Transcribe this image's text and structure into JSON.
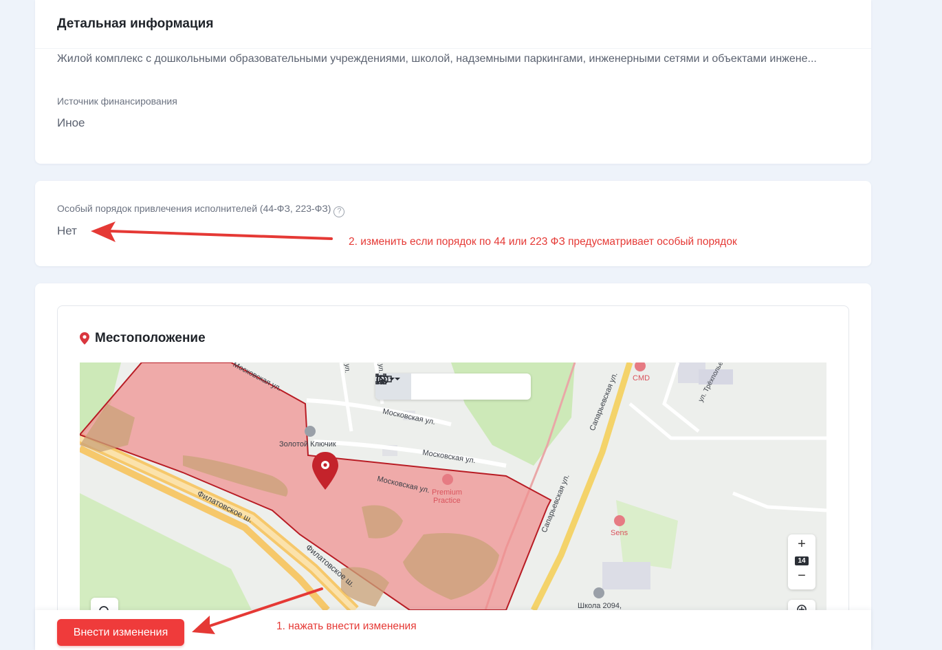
{
  "details": {
    "title": "Детальная информация",
    "description": "Жилой комплекс с дошкольными образовательными учреждениями, школой, надземными паркингами, инженерными сетями и объектами инжене...",
    "funding_label": "Источник финансирования",
    "funding_value": "Иное"
  },
  "special_order": {
    "label": "Особый порядок привлечения исполнителей (44-ФЗ, 223-ФЗ)",
    "help_glyph": "?",
    "value": "Нет",
    "annotation": "2. изменить если порядок по 44 или 223 ФЗ предусматривает особый порядок"
  },
  "location": {
    "title": "Местоположение",
    "icon": "location-pin-icon",
    "map": {
      "zoom_level": "14",
      "zoom_in": "+",
      "zoom_out": "−",
      "labels": {
        "golden_key": "Золотой Ключик",
        "moskovskaya_1": "Московская ул.",
        "moskovskaya_2": "Московская ул.",
        "moskovskaya_3": "Московская ул.",
        "moskovskaya_top": "Московская ул.",
        "filatovskoe_1": "Филатовское ш.",
        "filatovskoe_2": "Филатовское ш.",
        "saparyevskaya_1": "Сапарьевская ул.",
        "saparyevskaya_2": "Сапарьевская ул.",
        "trekhpolye": "ул. Трёхполье",
        "premium": "Premium",
        "practice": "Practice",
        "cmd": "CMD",
        "sens": "Sens",
        "school": "Школа 2094,",
        "vertical_ul": "ул.",
        "vertical_ul2": "ул."
      },
      "colors": {
        "polygon_fill": "#f08f8f",
        "polygon_stroke": "#b81c24",
        "marker": "#c4232b",
        "road": "#f6c86b",
        "park": "#cde9b8"
      }
    }
  },
  "footer": {
    "submit_label": "Внести изменения",
    "annotation": "1. нажать внести изменения"
  }
}
